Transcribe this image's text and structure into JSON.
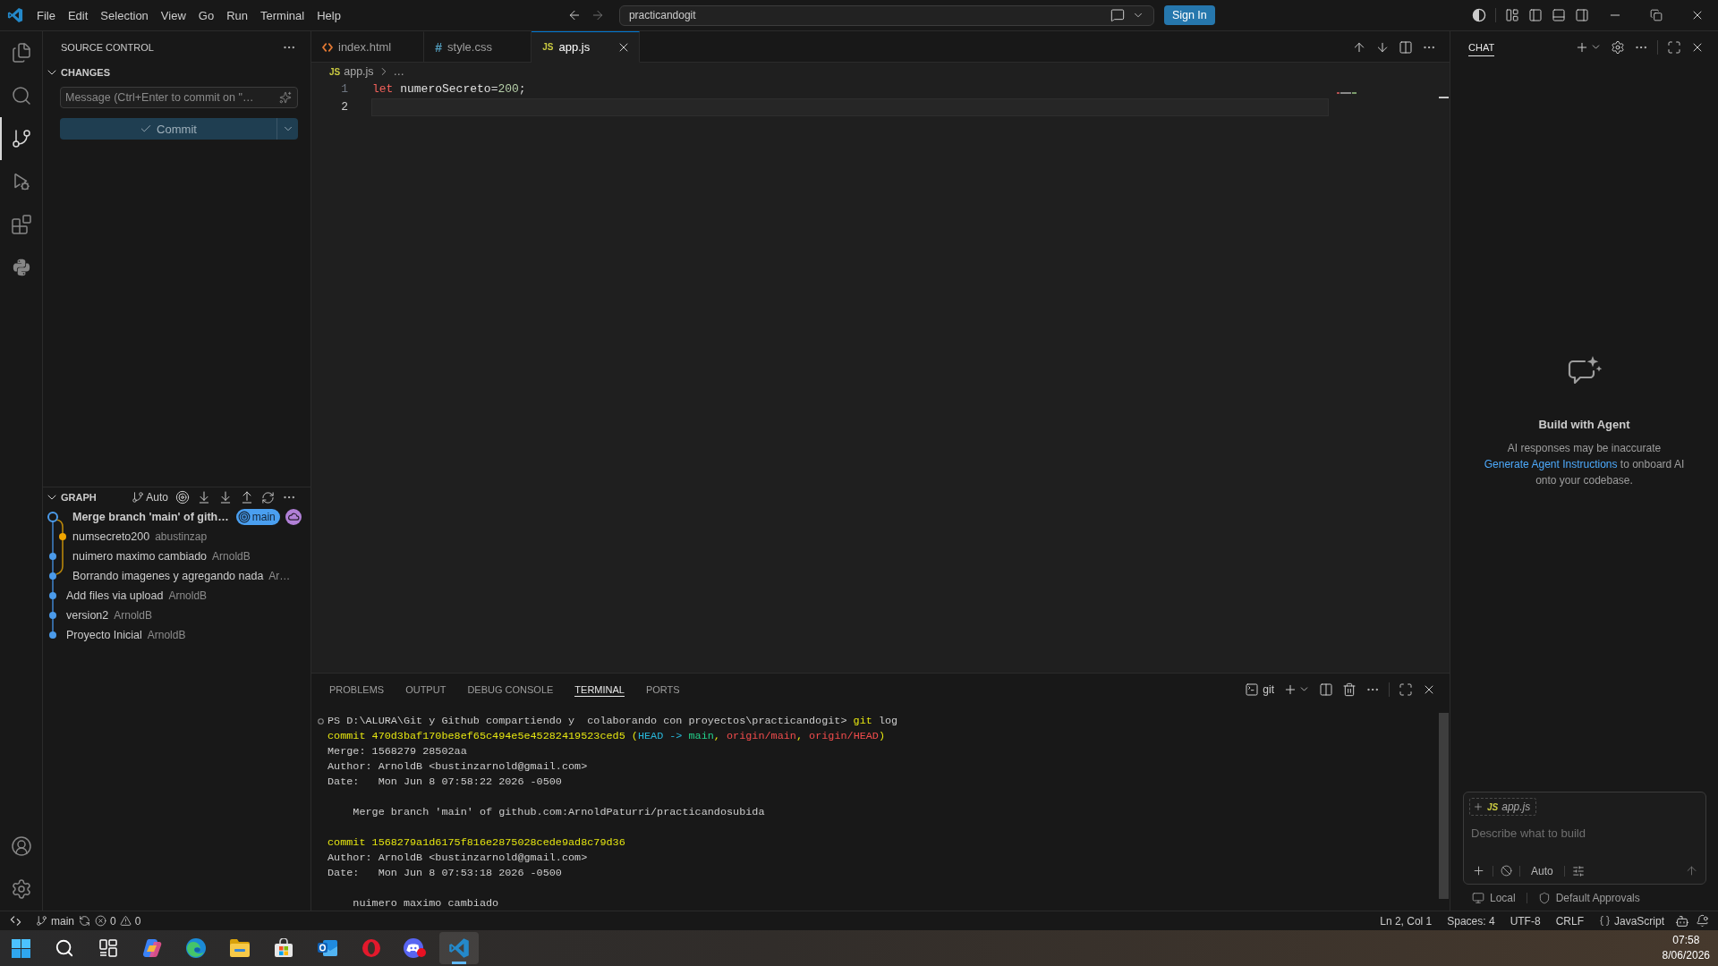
{
  "title_bar": {
    "menu": [
      "File",
      "Edit",
      "Selection",
      "View",
      "Go",
      "Run",
      "Terminal",
      "Help"
    ],
    "command_center": "practicandogit",
    "sign_in": "Sign In"
  },
  "activity_bar": [
    {
      "kind": "explorer",
      "selected": false
    },
    {
      "kind": "search",
      "selected": false
    },
    {
      "kind": "source_control",
      "selected": true
    },
    {
      "kind": "run",
      "selected": false
    },
    {
      "kind": "extensions",
      "selected": false
    },
    {
      "kind": "python",
      "selected": false
    }
  ],
  "sidebar": {
    "title": "SOURCE CONTROL",
    "changes": {
      "title": "CHANGES",
      "expanded": true,
      "message": {
        "placeholder": "Message (Ctrl+Enter to commit on \"…"
      },
      "commit_button": "Commit"
    },
    "graph": {
      "title": "GRAPH",
      "expanded": true,
      "filter": "Auto",
      "commits": [
        {
          "kind": "merge",
          "message": "Merge branch 'main' of gith…",
          "refs": [
            {
              "kind": "local",
              "label": "main"
            },
            {
              "kind": "remote"
            }
          ]
        },
        {
          "kind": "side",
          "message": "numsecreto200",
          "author": "abustinzap"
        },
        {
          "kind": "commit",
          "message": "nuimero maximo cambiado",
          "author": "ArnoldB"
        },
        {
          "kind": "base",
          "message": "Borrando imagenes y agregando nada",
          "author": "Ar…"
        },
        {
          "kind": "commit",
          "message": "Add files via upload",
          "author": "ArnoldB"
        },
        {
          "kind": "commit",
          "message": "version2",
          "author": "ArnoldB"
        },
        {
          "kind": "commit",
          "message": "Proyecto Inicial",
          "author": "ArnoldB"
        }
      ]
    }
  },
  "editor": {
    "tabs": [
      {
        "kind": "html",
        "label": "index.html",
        "selected": false
      },
      {
        "kind": "css",
        "icon": "#",
        "label": "style.css",
        "selected": false
      },
      {
        "kind": "js",
        "icon": "JS",
        "label": "app.js",
        "selected": true
      }
    ],
    "breadcrumb": {
      "icon": "JS",
      "file": "app.js",
      "symbol": "…"
    },
    "lines": [
      {
        "number": "1",
        "current": false,
        "tokens": [
          {
            "kind": "keyword",
            "text": "let"
          },
          {
            "kind": "identifier",
            "text": " numeroSecreto"
          },
          {
            "kind": "operator",
            "text": "="
          },
          {
            "kind": "number",
            "text": "200"
          },
          {
            "kind": "punctuation",
            "text": ";"
          }
        ]
      },
      {
        "number": "2",
        "current": true
      }
    ]
  },
  "panel": {
    "tabs": [
      {
        "label": "PROBLEMS",
        "selected": false
      },
      {
        "label": "OUTPUT",
        "selected": false
      },
      {
        "label": "DEBUG CONSOLE",
        "selected": false
      },
      {
        "label": "TERMINAL",
        "selected": true
      },
      {
        "label": "PORTS",
        "selected": false
      }
    ],
    "terminal": {
      "name": "git",
      "prompt": {
        "segments": [
          {
            "kind": "text",
            "text": "PS D:\\ALURA\\Git y Github compartiendo y  colaborando con proyectos\\practicandogit> "
          },
          {
            "kind": "command",
            "text": "git"
          },
          {
            "kind": "text",
            "text": " log"
          }
        ]
      },
      "blocks": [
        {
          "indented": false,
          "lines": [
            {
              "segments": [
                {
                  "kind": "hash",
                  "text": "commit 470d3baf170be8ef65c494e5e45282419523ced5 ("
                },
                {
                  "kind": "head",
                  "text": "HEAD -> "
                },
                {
                  "kind": "local",
                  "text": "main"
                },
                {
                  "kind": "hash",
                  "text": ", "
                },
                {
                  "kind": "remote",
                  "text": "origin/main"
                },
                {
                  "kind": "hash",
                  "text": ", "
                },
                {
                  "kind": "remote",
                  "text": "origin/HEAD"
                },
                {
                  "kind": "hash",
                  "text": ")"
                }
              ]
            },
            {
              "segments": [
                {
                  "kind": "text",
                  "text": "Merge: 1568279 28502aa"
                }
              ]
            },
            {
              "segments": [
                {
                  "kind": "text",
                  "text": "Author: ArnoldB <bustinzarnold@gmail.com>"
                }
              ]
            },
            {
              "segments": [
                {
                  "kind": "text",
                  "text": "Date:   Mon Jun 8 07:58:22 2026 -0500"
                }
              ]
            }
          ]
        },
        {
          "indented": true,
          "lines": [
            {
              "segments": [
                {
                  "kind": "text",
                  "text": "Merge branch 'main' of github.com:ArnoldPaturri/practicandosubida"
                }
              ]
            }
          ]
        },
        {
          "indented": false,
          "lines": [
            {
              "segments": [
                {
                  "kind": "hash",
                  "text": "commit 1568279a1d6175f816e2875028cede9ad8c79d36"
                }
              ]
            },
            {
              "segments": [
                {
                  "kind": "text",
                  "text": "Author: ArnoldB <bustinzarnold@gmail.com>"
                }
              ]
            },
            {
              "segments": [
                {
                  "kind": "text",
                  "text": "Date:   Mon Jun 8 07:53:18 2026 -0500"
                }
              ]
            }
          ]
        },
        {
          "indented": true,
          "lines": [
            {
              "segments": [
                {
                  "kind": "text",
                  "text": "nuimero maximo cambiado"
                }
              ]
            }
          ]
        }
      ]
    }
  },
  "chat": {
    "title": "CHAT",
    "heading": "Build with Agent",
    "notice": "AI responses may be inaccurate",
    "link": "Generate Agent Instructions",
    "link_suffix": " to onboard AI onto your codebase.",
    "attachment": {
      "icon": "JS",
      "label": "app.js"
    },
    "input": {
      "placeholder": "Describe what to build"
    },
    "mode": "Auto",
    "footer": [
      {
        "kind": "local",
        "label": "Local"
      },
      {
        "kind": "approvals",
        "label": "Default Approvals"
      }
    ]
  },
  "status_bar": {
    "branch": "main",
    "errors": "0",
    "warnings": "0",
    "items": [
      "Ln 2, Col 1",
      "Spaces: 4",
      "UTF-8",
      "CRLF"
    ],
    "language": "JavaScript"
  },
  "taskbar": {
    "apps": [
      {
        "kind": "start",
        "selected": false
      },
      {
        "kind": "search",
        "selected": false
      },
      {
        "kind": "task_view",
        "selected": false
      },
      {
        "kind": "copilot",
        "selected": false
      },
      {
        "kind": "edge",
        "selected": false
      },
      {
        "kind": "files",
        "selected": false
      },
      {
        "kind": "store",
        "selected": false
      },
      {
        "kind": "outlook",
        "selected": false
      },
      {
        "kind": "opera",
        "selected": false
      },
      {
        "kind": "discord",
        "selected": false
      },
      {
        "kind": "vscode",
        "selected": true
      }
    ],
    "time": "07:58",
    "date": "8/06/2026"
  }
}
